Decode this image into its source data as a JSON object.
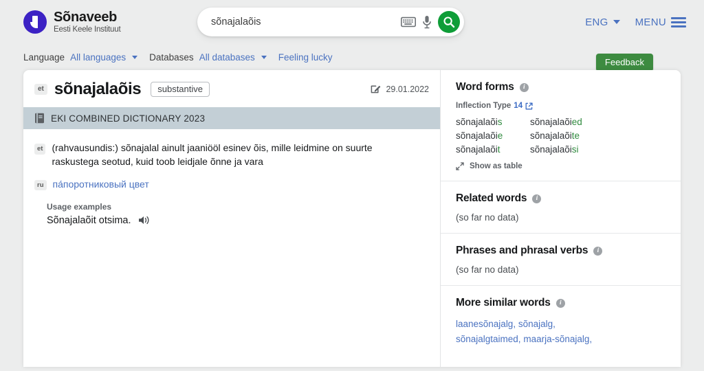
{
  "header": {
    "brand_name": "Sõnaveeb",
    "brand_subtitle": "Eesti Keele Instituut",
    "search_value": "sõnajalaõis",
    "search_placeholder": "",
    "keyboard_icon": "keyboard-icon",
    "mic_icon": "microphone-icon",
    "search_icon": "search-icon",
    "language_button": "ENG",
    "menu_button": "MENU",
    "accent_green": "#0f9d38",
    "accent_blue": "#4a72c0",
    "logo_color": "#3c22c4"
  },
  "filterbar": {
    "language_label": "Language",
    "language_value": "All languages",
    "databases_label": "Databases",
    "databases_value": "All databases",
    "feeling_lucky": "Feeling lucky",
    "feedback_label": "Feedback",
    "feedback_color": "#3d8b40"
  },
  "entry": {
    "lang_tag": "et",
    "headword": "sõnajalaõis",
    "part_of_speech": "substantive",
    "edit_icon": "edit-pencil-icon",
    "date": "29.01.2022",
    "dictionary_icon": "book-icon",
    "dictionary_name": "EKI COMBINED DICTIONARY 2023",
    "definition_tag": "et",
    "definition": "(rahvausundis:) sõnajalal ainult jaaniööl esinev õis, mille leidmine on suurte raskustega seotud, kuid toob leidjale õnne ja vara",
    "translation_tag": "ru",
    "translation": "па́поротниковый цвет",
    "usage_title": "Usage examples",
    "usage_example": "Sõnajalaõit otsima.",
    "speaker_icon": "speaker-audio-icon"
  },
  "sidebar": {
    "word_forms": {
      "title": "Word forms",
      "inflection_label": "Inflection Type",
      "inflection_number": "14",
      "external_icon": "external-link-icon",
      "forms": [
        {
          "stem": "sõnajalaõi",
          "suffix": "s"
        },
        {
          "stem": "sõnajalaõi",
          "suffix": "ed"
        },
        {
          "stem": "sõnajalaõi",
          "suffix": "e"
        },
        {
          "stem": "sõnajalaõi",
          "suffix": "te"
        },
        {
          "stem": "sõnajalaõi",
          "suffix": "t"
        },
        {
          "stem": "sõnajalaõi",
          "suffix": "si"
        }
      ],
      "show_as_table": "Show as table",
      "expand_icon": "expand-arrows-icon",
      "suffix_color": "#2f8a3e"
    },
    "related_words": {
      "title": "Related words",
      "empty": "(so far no data)"
    },
    "phrases": {
      "title": "Phrases and phrasal verbs",
      "empty": "(so far no data)"
    },
    "similar_words": {
      "title": "More similar words",
      "items": [
        "laanesõnajalg,",
        "sõnajalg,",
        "sõnajalgtaimed,",
        "maarja-sõnajalg,"
      ]
    }
  }
}
